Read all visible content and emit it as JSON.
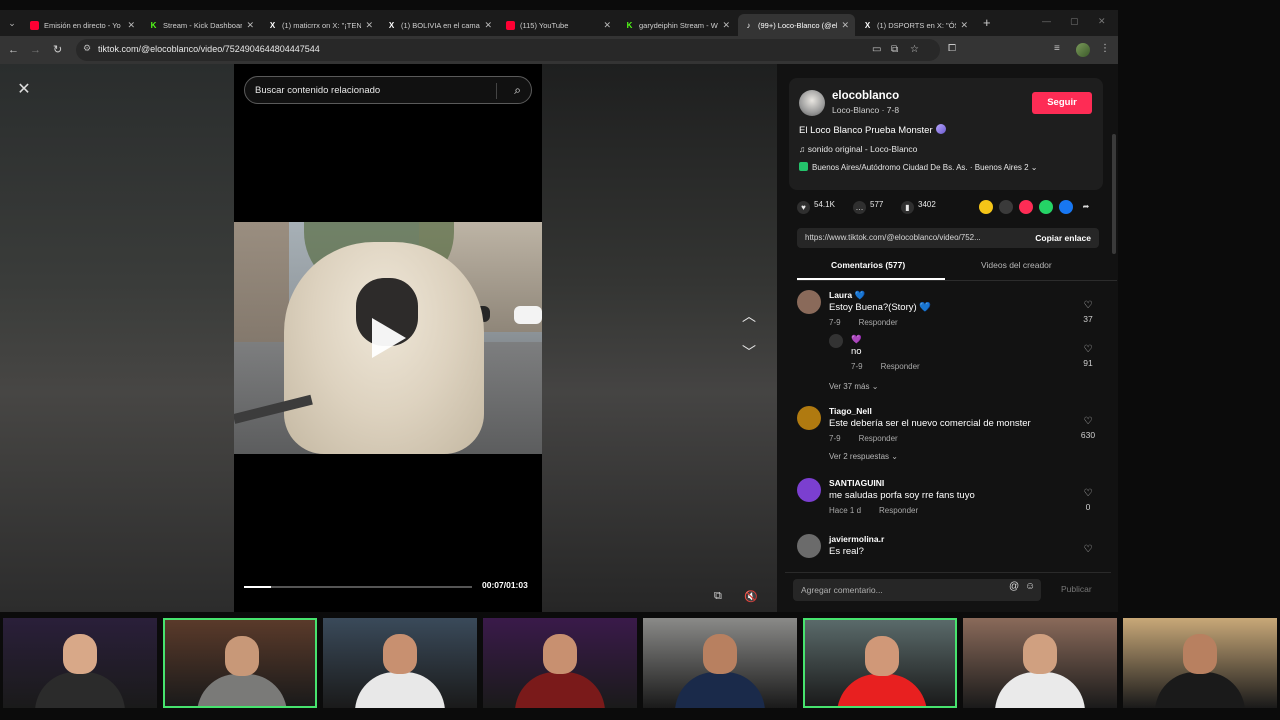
{
  "browser": {
    "tabs": [
      {
        "title": "Emisión en directo - Yo",
        "icon": "youtube-icon",
        "color": "#ff0033",
        "glyph": ""
      },
      {
        "title": "Stream - Kick Dashboard",
        "icon": "kick-icon",
        "color": "#53fc18",
        "glyph": "K"
      },
      {
        "title": "(1) maticrrx on X: \"¡TEN",
        "icon": "x-icon",
        "color": "#ffffff",
        "glyph": "X"
      },
      {
        "title": "(1) BOLIVIA en el camar",
        "icon": "x-icon",
        "color": "#ffffff",
        "glyph": "X"
      },
      {
        "title": "(115) YouTube",
        "icon": "youtube-icon",
        "color": "#ff0033",
        "glyph": ""
      },
      {
        "title": "garydeiphin Stream - W",
        "icon": "kick-icon",
        "color": "#53fc18",
        "glyph": "K"
      },
      {
        "title": "(99+) Loco-Blanco (@el",
        "icon": "tiktok-icon",
        "color": "#ffffff",
        "glyph": "♪"
      },
      {
        "title": "(1) DSPORTS en X: \"ÓS",
        "icon": "x-icon",
        "color": "#ffffff",
        "glyph": "X"
      }
    ],
    "url": "tiktok.com/@elocoblanco/video/7524904644804447544"
  },
  "search": {
    "placeholder": "Buscar contenido relacionado"
  },
  "video": {
    "progress": 0.12,
    "time": "00:07/01:03"
  },
  "creator": {
    "name": "elocoblanco",
    "sub": "Loco-Blanco · 7-8",
    "follow_label": "Seguir",
    "description": "El Loco Blanco Prueba Monster",
    "music": "sonido original - Loco-Blanco",
    "location": "Buenos Aires/Autódromo Ciudad De Bs. As. · Buenos Aires  2"
  },
  "stats": {
    "likes": "54.1K",
    "comments": "577",
    "saves": "3402"
  },
  "share_colors": [
    "#f5c518",
    "#3a3a3a",
    "#fe2c55",
    "#25d366",
    "#1877f2"
  ],
  "link": {
    "url": "https://www.tiktok.com/@elocoblanco/video/752...",
    "copy_label": "Copiar enlace"
  },
  "panel_tabs": {
    "comments": "Comentarios (577)",
    "creator_videos": "Videos del creador"
  },
  "comments": [
    {
      "user": "Laura 💙",
      "text": "Estoy Buena?(Story) 💙",
      "date": "7-9",
      "reply": "Responder",
      "likes": "37",
      "avatar": "#8a6a5a"
    },
    {
      "user": "Tiago_Nell",
      "text": "Este debería ser el nuevo comercial de monster",
      "date": "7-9",
      "reply": "Responder",
      "likes": "630",
      "avatar": "#b07a10"
    },
    {
      "user": "SANTIAGUINI",
      "text": "me saludas porfa soy rre fans tuyo",
      "date": "Hace 1 d",
      "reply": "Responder",
      "likes": "0",
      "avatar": "#7b3fd0"
    },
    {
      "user": "javiermolina.r",
      "text": "Es real?",
      "date": "",
      "reply": "",
      "likes": "",
      "avatar": "#6b6b6b"
    }
  ],
  "reply_thread": {
    "user": "💜",
    "text": "no",
    "date": "7-9",
    "reply": "Responder",
    "likes": "91",
    "more": "Ver 37 más ⌄"
  },
  "more_replies_2": "Ver 2 respuestas ⌄",
  "comment_bar": {
    "placeholder": "Agregar comentario...",
    "publish": "Publicar"
  },
  "webcams": [
    {
      "bg": "#2a1f3a",
      "shirt": "#2b2b2b",
      "skin": "#d8a888",
      "selected": false
    },
    {
      "bg": "#5a3a2a",
      "shirt": "#7a7a78",
      "skin": "#c89878",
      "selected": true
    },
    {
      "bg": "#3a4a5a",
      "shirt": "#e8e8e8",
      "skin": "#c89070",
      "selected": false
    },
    {
      "bg": "#3a1a4a",
      "shirt": "#7a1a1a",
      "skin": "#c89070",
      "selected": false
    },
    {
      "bg": "#8a8a88",
      "shirt": "#1a2a4a",
      "skin": "#b88060",
      "selected": false
    },
    {
      "bg": "#5a6a6a",
      "shirt": "#e82020",
      "skin": "#d09878",
      "selected": true
    },
    {
      "bg": "#8a6a5a",
      "shirt": "#eaeaea",
      "skin": "#d0a080",
      "selected": false
    },
    {
      "bg": "#c8a878",
      "shirt": "#1a1a1a",
      "skin": "#b88060",
      "selected": false
    }
  ]
}
